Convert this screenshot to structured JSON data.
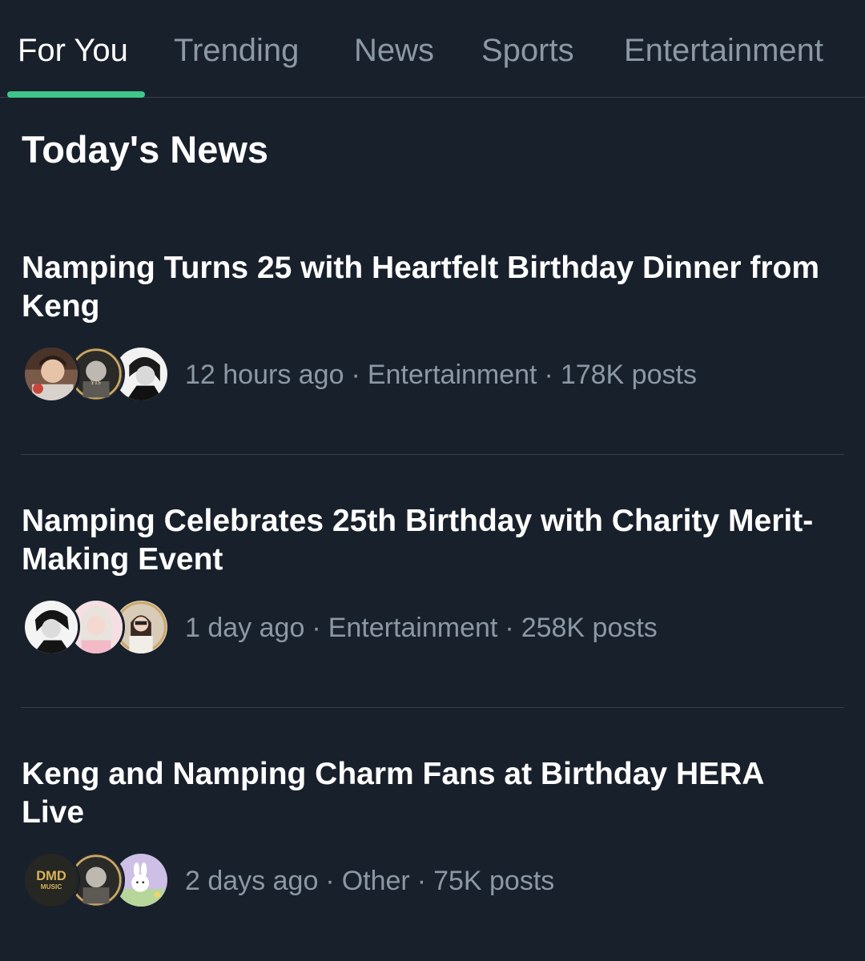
{
  "tabs": [
    {
      "label": "For You",
      "active": true
    },
    {
      "label": "Trending",
      "active": false
    },
    {
      "label": "News",
      "active": false
    },
    {
      "label": "Sports",
      "active": false
    },
    {
      "label": "Entertainment",
      "active": false
    }
  ],
  "section_title": "Today's News",
  "separator": "·",
  "stories": [
    {
      "headline": "Namping Turns 25 with Heartfelt Birthday Dinner from Keng",
      "time": "12 hours ago",
      "category": "Entertainment",
      "posts": "178K posts",
      "avatars": [
        "person-photo",
        "logo-badge",
        "person-photo"
      ]
    },
    {
      "headline": "Namping Celebrates 25th Birthday with Charity Merit-Making Event",
      "time": "1 day ago",
      "category": "Entertainment",
      "posts": "258K posts",
      "avatars": [
        "person-photo",
        "person-photo",
        "person-photo"
      ]
    },
    {
      "headline": "Keng and Namping Charm Fans at Birthday HERA Live",
      "time": "2 days ago",
      "category": "Other",
      "posts": "75K posts",
      "avatars": [
        "dmd-music-logo",
        "logo-badge",
        "bunny-illustration"
      ],
      "logo_text": "DMD",
      "logo_subtext": "MUSIC"
    }
  ],
  "colors": {
    "background": "#18202b",
    "text_primary": "#ffffff",
    "text_secondary": "#8b98a5",
    "accent": "#3fc68a",
    "divider": "#333c48"
  }
}
